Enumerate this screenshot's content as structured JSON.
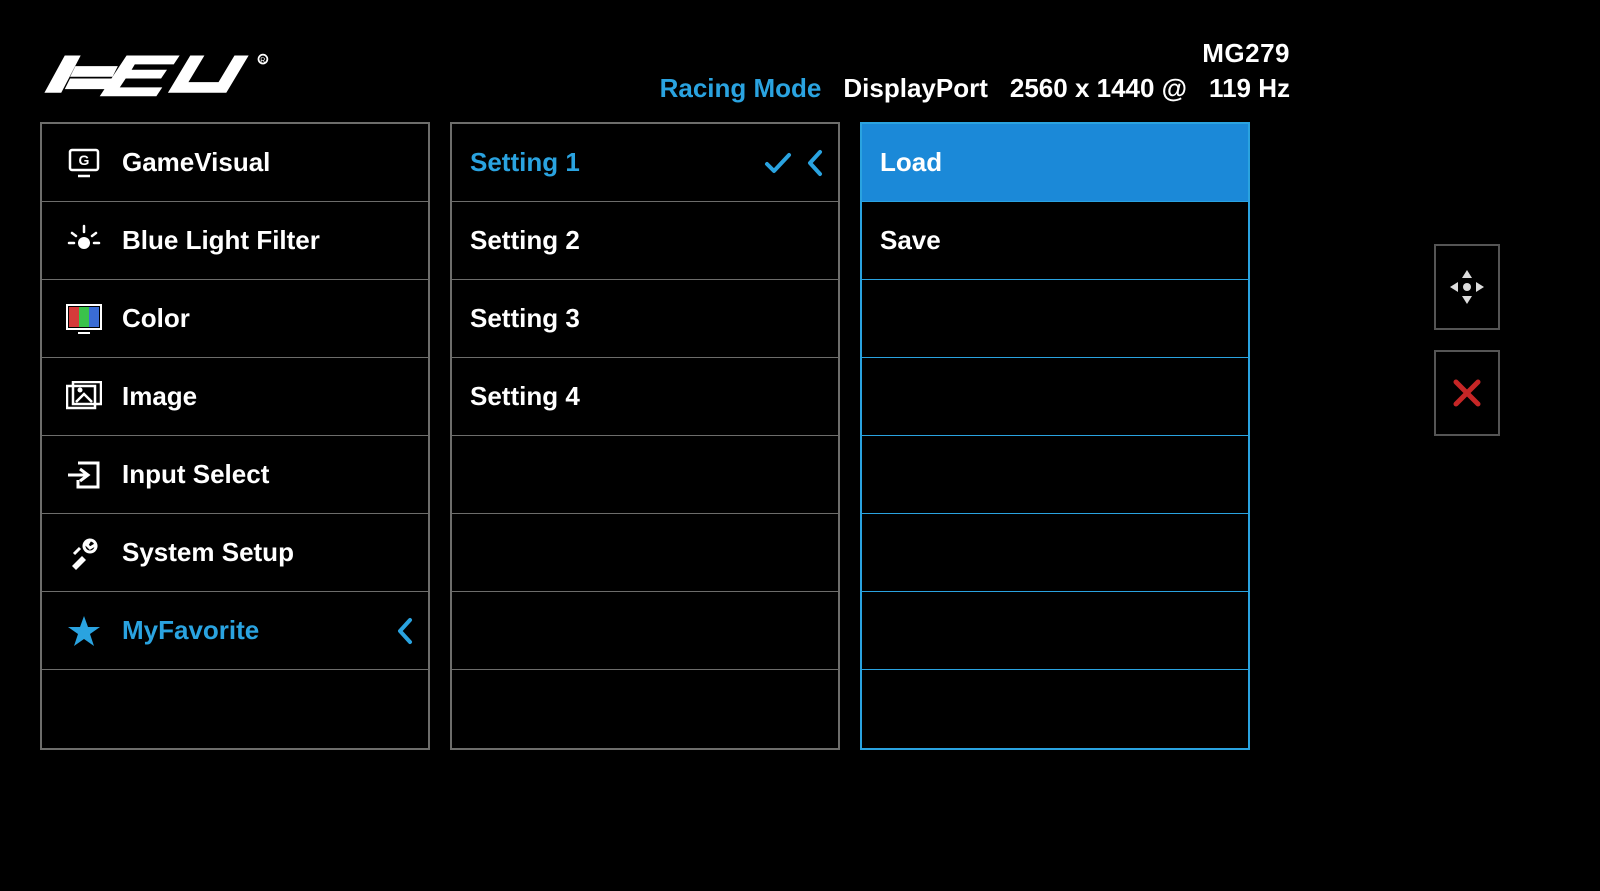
{
  "brand": "ASUS",
  "header": {
    "model": "MG279",
    "mode": "Racing Mode",
    "input": "DisplayPort",
    "resolution": "2560 x 1440 @",
    "refresh": "119 Hz"
  },
  "main_menu": {
    "items": [
      {
        "label": "GameVisual"
      },
      {
        "label": "Blue Light Filter"
      },
      {
        "label": "Color"
      },
      {
        "label": "Image"
      },
      {
        "label": "Input Select"
      },
      {
        "label": "System Setup"
      },
      {
        "label": "MyFavorite"
      }
    ]
  },
  "sub_menu": {
    "items": [
      {
        "label": "Setting 1"
      },
      {
        "label": "Setting 2"
      },
      {
        "label": "Setting 3"
      },
      {
        "label": "Setting 4"
      }
    ]
  },
  "action_menu": {
    "items": [
      {
        "label": "Load"
      },
      {
        "label": "Save"
      }
    ]
  },
  "colors": {
    "accent": "#2aa3e0",
    "border": "#6d6d6b"
  }
}
